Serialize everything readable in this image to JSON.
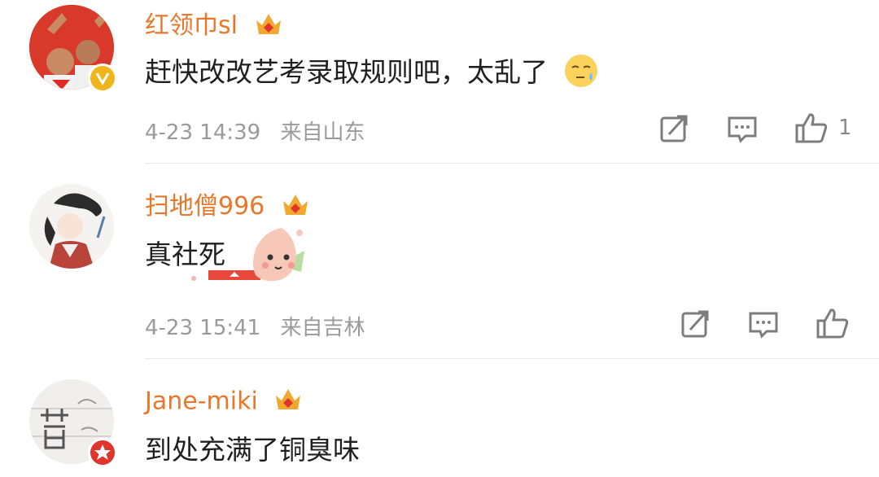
{
  "comments": [
    {
      "username": "红领巾sl",
      "text": "赶快改改艺考录取规则吧，太乱了",
      "emoji": "sweat-face",
      "date": "4-23 14:39",
      "location": "来自山东",
      "likes": "1",
      "avatar_badge": "verified-gold"
    },
    {
      "username": "扫地僧996",
      "text": "真社死",
      "emoji": "peach-sticker",
      "date": "4-23 15:41",
      "location": "来自吉林",
      "likes": "",
      "avatar_badge": ""
    },
    {
      "username": "Jane-miki",
      "text": "到处充满了铜臭味",
      "emoji": "",
      "date": "",
      "location": "",
      "likes": "",
      "avatar_badge": "verified-red"
    }
  ],
  "colors": {
    "username": "#e8772a",
    "meta": "#9a9a9a",
    "crown": "#f0a92e",
    "badge_gold": "#f1b51c",
    "badge_red": "#e0352c"
  },
  "icons": [
    "repost-icon",
    "comment-icon",
    "like-icon",
    "vip-crown-icon"
  ]
}
